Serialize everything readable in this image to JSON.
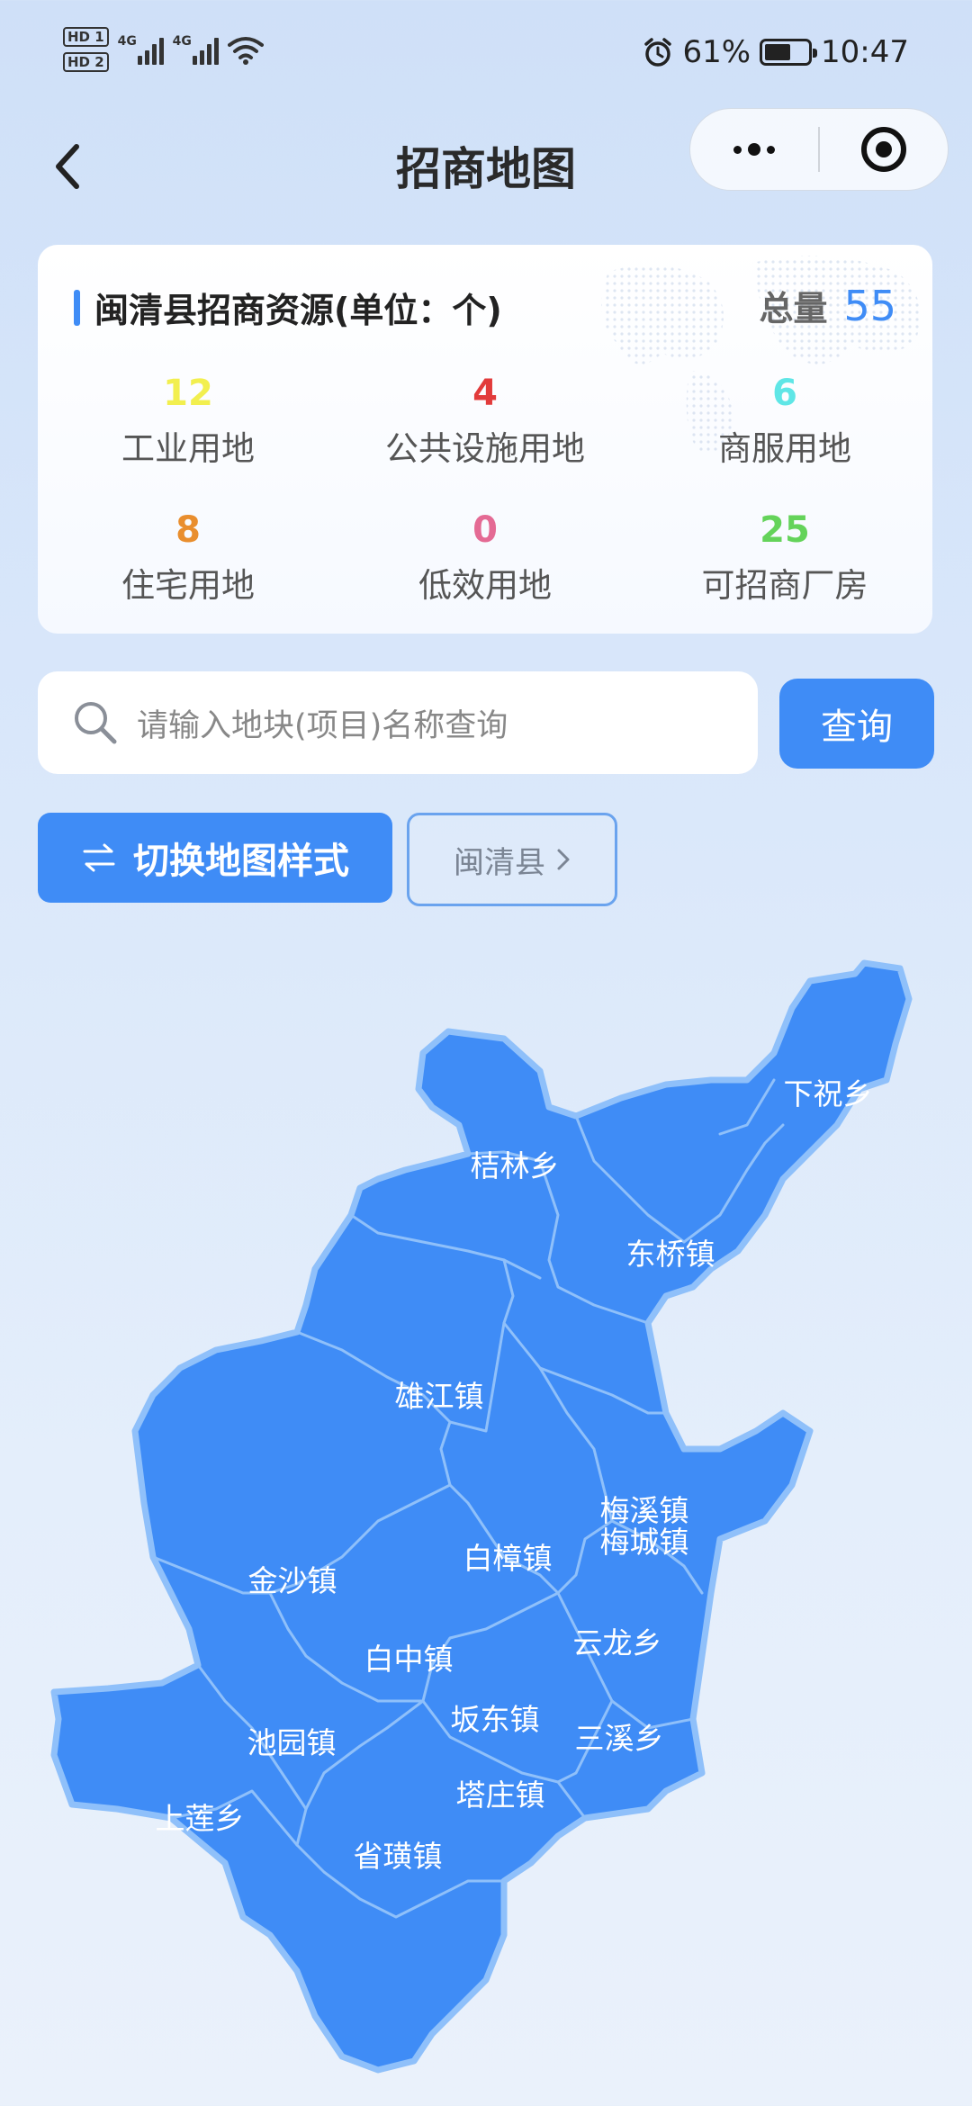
{
  "status_bar": {
    "hd1": "HD 1",
    "hd2": "HD 2",
    "net1": "4G",
    "net2": "4G",
    "battery_pct": "61%",
    "battery_level": 0.61,
    "time": "10:47"
  },
  "nav": {
    "title": "招商地图"
  },
  "stats": {
    "title": "闽清县招商资源(单位：个)",
    "total_label": "总量",
    "total_value": "55",
    "items": [
      {
        "value": "12",
        "label": "工业用地",
        "color": "#f2ef4f"
      },
      {
        "value": "4",
        "label": "公共设施用地",
        "color": "#e23b3b"
      },
      {
        "value": "6",
        "label": "商服用地",
        "color": "#5fe6e6"
      },
      {
        "value": "8",
        "label": "住宅用地",
        "color": "#e98e2e"
      },
      {
        "value": "0",
        "label": "低效用地",
        "color": "#e46a94"
      },
      {
        "value": "25",
        "label": "可招商厂房",
        "color": "#64d35a"
      }
    ]
  },
  "search": {
    "placeholder": "请输入地块(项目)名称查询",
    "button_label": "查询"
  },
  "controls": {
    "switch_label": "切换地图样式",
    "county_label": "闽清县"
  },
  "map": {
    "fill_color": "#3f8cf6",
    "border_color": "#8fc0fa",
    "towns": [
      "下祝乡",
      "桔林乡",
      "东桥镇",
      "雄江镇",
      "梅溪镇",
      "梅城镇",
      "白樟镇",
      "金沙镇",
      "云龙乡",
      "白中镇",
      "坂东镇",
      "池园镇",
      "三溪乡",
      "上莲乡",
      "塔庄镇",
      "省璜镇"
    ]
  }
}
